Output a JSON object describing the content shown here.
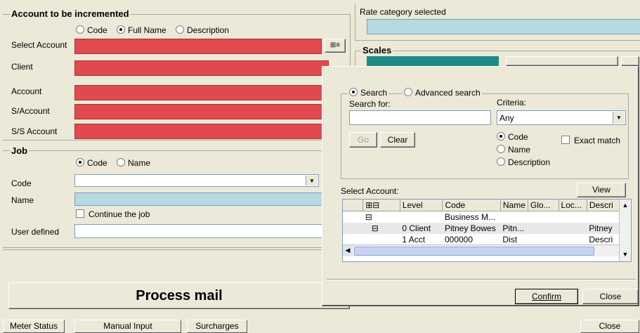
{
  "account_group": {
    "title": "Account to be incremented",
    "radios": [
      {
        "label": "Code",
        "selected": false
      },
      {
        "label": "Full Name",
        "selected": true
      },
      {
        "label": "Description",
        "selected": false
      }
    ],
    "fields": [
      {
        "label": "Select Account"
      },
      {
        "label": "Client"
      },
      {
        "label": "Account"
      },
      {
        "label": "S/Account"
      },
      {
        "label": "S/S Account"
      }
    ]
  },
  "job_group": {
    "title": "Job",
    "radios": [
      {
        "label": "Code",
        "selected": true
      },
      {
        "label": "Name",
        "selected": false
      }
    ],
    "code_label": "Code",
    "name_label": "Name",
    "continue_label": "Continue the job",
    "user_defined_label": "User defined"
  },
  "rate": {
    "label": "Rate category selected"
  },
  "scales": {
    "title": "Scales"
  },
  "process_mail": "Process mail",
  "popup": {
    "search_radio": "Search",
    "advanced_radio": "Advanced search",
    "search_for_label": "Search for:",
    "criteria_label": "Criteria:",
    "criteria_value": "Any",
    "go_button": "Go",
    "clear_button": "Clear",
    "match_radios": [
      {
        "label": "Code",
        "selected": true
      },
      {
        "label": "Name",
        "selected": false
      },
      {
        "label": "Description",
        "selected": false
      }
    ],
    "exact_match": "Exact match",
    "select_account_label": "Select Account:",
    "view_button": "View",
    "columns": [
      "Level",
      "Code",
      "Name",
      "Glo...",
      "Loc...",
      "Descri"
    ],
    "rows": [
      {
        "tree": "⊟",
        "level": "",
        "code": "Business M...",
        "name": "",
        "desc": ""
      },
      {
        "tree": "⊟",
        "level": "0 Client",
        "code": "Pitney Bowes",
        "name": "Pitn...",
        "desc": "Pitney"
      },
      {
        "tree": "",
        "level": "1 Acct",
        "code": "000000",
        "name": "Dist",
        "desc": "Descri"
      }
    ],
    "confirm_button": "Confirm",
    "close_button": "Close"
  },
  "bottom_bar": {
    "meter_status": "Meter Status",
    "manual_input": "Manual Input",
    "surcharges": "Surcharges",
    "close": "Close"
  },
  "colors": {
    "required_field": "#e04a4f",
    "readonly_field": "#b6d9e2",
    "scale_bar": "#1f8a86",
    "window_bg": "#ece9d8"
  }
}
